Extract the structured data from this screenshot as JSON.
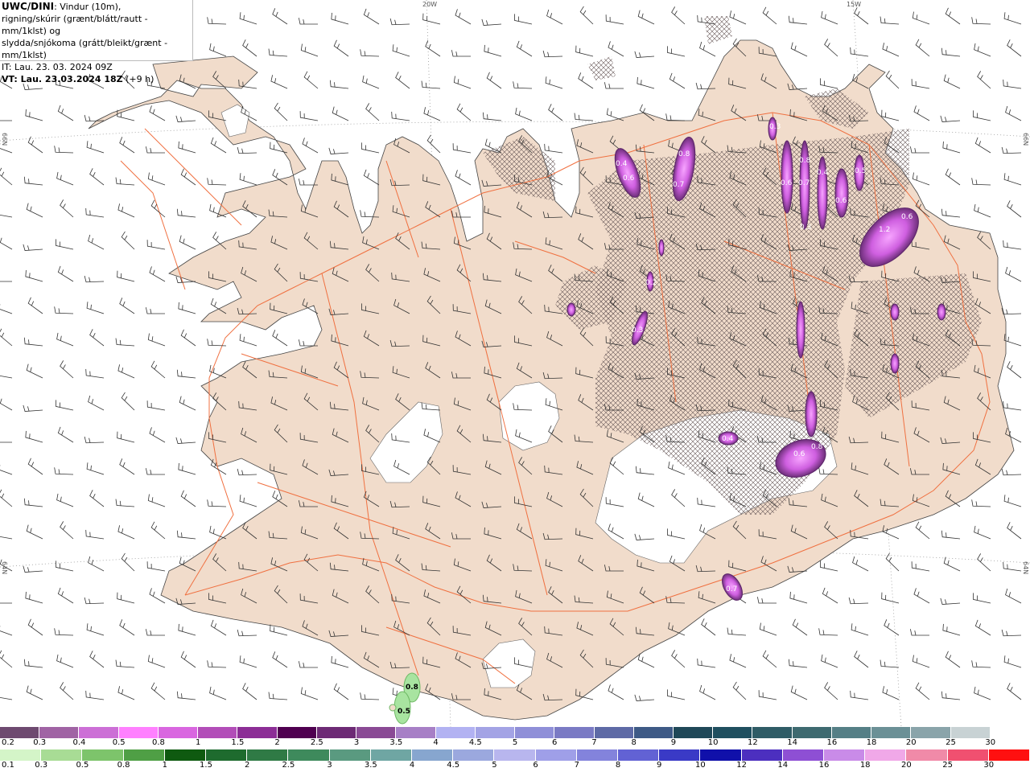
{
  "header": {
    "line1_bold": "UWC/DINI",
    "line1_rest": ": Vindur (10m),",
    "line2": "rigning/skúrir (grænt/blátt/rautt - mm/1klst) og",
    "line3": "slydda/snjókoma (grátt/bleikt/grænt - mm/1klst)",
    "line4": "IT: Lau. 23. 03. 2024 09Z",
    "line5_bold": "VT: Lau. 23.03.2024 18Z",
    "line5_rest": " (+9 h)"
  },
  "coords": {
    "top_20w": "20W",
    "top_15w": "15W",
    "left_66n": "66N",
    "right_66n": "66N",
    "left_64n": "64N",
    "right_64n": "64N"
  },
  "precip_labels": {
    "n1": "0.8",
    "n2": "0.5",
    "m1": "0.4",
    "m2": "0.6",
    "m3": "0.8",
    "m4": "0.7",
    "m5": "0.3",
    "m6": "0.6",
    "m7": "0.8",
    "m8": "0.4",
    "m9": "0.5",
    "m10": "0.7",
    "m11": "0.6",
    "m12": "0.6",
    "m13": "1.2",
    "m14": "0.3",
    "m15": "0.2",
    "m16": "0.3",
    "m17": "0.6",
    "m18": "0.8",
    "m19": "0.4",
    "m20": "0.7"
  },
  "legend_snow": {
    "labels": [
      "0.2",
      "0.3",
      "0.4",
      "0.5",
      "0.8",
      "1",
      "1.5",
      "2",
      "2.5",
      "3",
      "3.5",
      "4",
      "4.5",
      "5",
      "6",
      "7",
      "8",
      "9",
      "10",
      "12",
      "14",
      "16",
      "18",
      "20",
      "25",
      "30"
    ],
    "colors": [
      "#6e4a70",
      "#a063a4",
      "#cc6fd6",
      "#ff80ff",
      "#d966e0",
      "#b24db8",
      "#8c2d96",
      "#4f0050",
      "#6d2a75",
      "#8a4a95",
      "#a77fc6",
      "#b2b2f2",
      "#a3a3e5",
      "#8f8fd8",
      "#7a7ac4",
      "#5e6aa6",
      "#3e5a86",
      "#1f4858",
      "#1f4f5f",
      "#2f5c66",
      "#3e6a70",
      "#557f86",
      "#6b9096",
      "#8aa4aa",
      "#c8d2d4",
      "#ffffff"
    ]
  },
  "legend_rain": {
    "labels": [
      "0.1",
      "0.3",
      "0.5",
      "0.8",
      "1",
      "1.5",
      "2",
      "2.5",
      "3",
      "3.5",
      "4",
      "4.5",
      "5",
      "6",
      "7",
      "8",
      "9",
      "10",
      "12",
      "14",
      "16",
      "18",
      "20",
      "25",
      "30"
    ],
    "colors": [
      "#d4f5c8",
      "#a8dc95",
      "#7dc46b",
      "#4f9f45",
      "#0f5a10",
      "#1e6b2e",
      "#2f7a45",
      "#3e8a5c",
      "#5a9a80",
      "#6fa6a3",
      "#87a6cf",
      "#9ba8de",
      "#b8b6ee",
      "#9f9fe8",
      "#8383dc",
      "#6262d4",
      "#3a3ac6",
      "#1010aa",
      "#4c2fbf",
      "#8e4fd4",
      "#c98be8",
      "#f0a8e8",
      "#f08aa8",
      "#f05070",
      "#ff1010"
    ]
  },
  "colors": {
    "land": "#f1dccb",
    "glacier": "#ffffff",
    "road": "#f07040",
    "barb": "#333333",
    "snow_dark": "#7a2f86",
    "snow_light": "#e07ef0",
    "rain": "#a8e4a0"
  }
}
